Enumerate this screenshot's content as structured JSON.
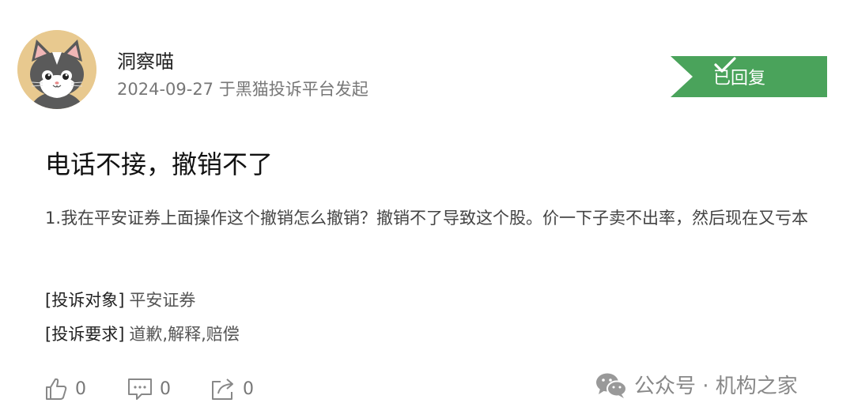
{
  "user": {
    "name": "洞察喵",
    "meta": "2024-09-27 于黑猫投诉平台发起"
  },
  "status": {
    "label": "已回复",
    "color": "#4aa35b"
  },
  "complaint": {
    "title": "电话不接，撤销不了",
    "body": "1.我在平安证券上面操作这个撤销怎么撤销？撤销不了导致这个股。价一下子卖不出率，然后现在又亏本",
    "target_label": "[投诉对象]",
    "target_value": "平安证券",
    "demand_label": "[投诉要求]",
    "demand_value": "道歉,解释,赔偿"
  },
  "actions": {
    "like_count": "0",
    "comment_count": "0",
    "share_count": "0"
  },
  "watermark": {
    "text": "公众号 · 机构之家"
  },
  "icons": [
    "cat-avatar",
    "check-icon",
    "thumbs-up-icon",
    "comment-icon",
    "share-icon",
    "wechat-icon"
  ]
}
